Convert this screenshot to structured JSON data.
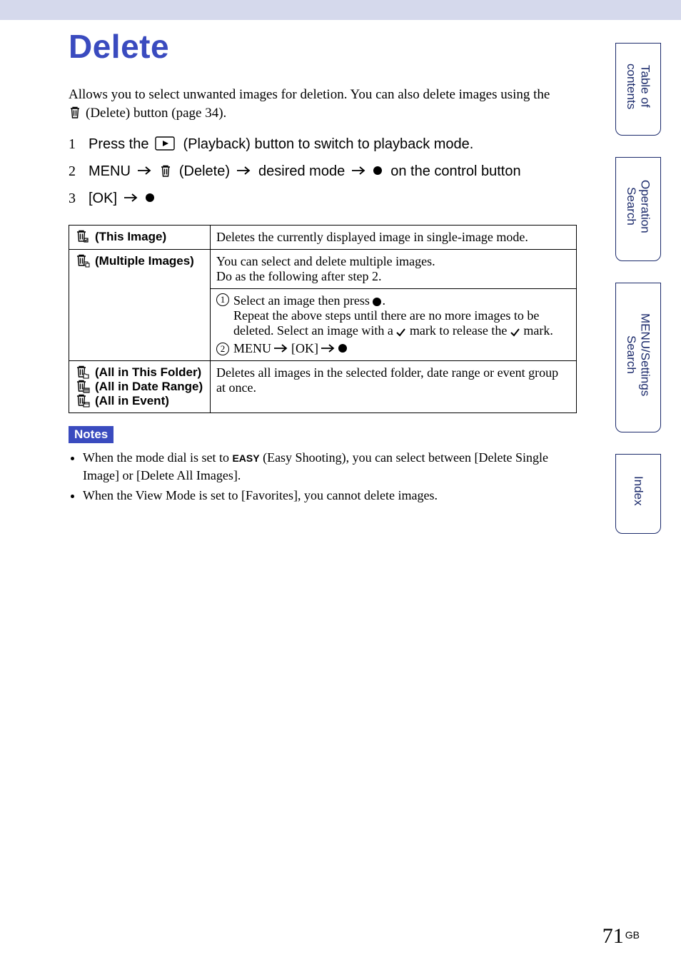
{
  "title": "Delete",
  "intro": {
    "line1": "Allows you to select unwanted images for deletion. You can also delete images using the",
    "line2_suffix": "(Delete) button (page 34)."
  },
  "steps": {
    "s1_a": "Press the",
    "s1_b": "(Playback) button to switch to playback mode.",
    "s2_a": "MENU",
    "s2_b": "(Delete)",
    "s2_c": "desired mode",
    "s2_d": "on the control button",
    "s3_a": "[OK]"
  },
  "table": {
    "r1_label": "(This Image)",
    "r1_desc": "Deletes the currently displayed image in single-image mode.",
    "r2_label": "(Multiple Images)",
    "r2_desc_a": "You can select and delete multiple images.",
    "r2_desc_b": "Do as the following after step 2.",
    "r2_step1_a": "Select an image then press",
    "r2_step1_b": ".",
    "r2_step1_c": "Repeat the above steps until there are no more images to be deleted. Select an image with a",
    "r2_step1_d": "mark to release the",
    "r2_step1_e": "mark.",
    "r2_step2_a": "MENU",
    "r2_step2_b": "[OK]",
    "r3_label_a": "(All in This Folder)",
    "r3_label_b": "(All in Date Range)",
    "r3_label_c": "(All in Event)",
    "r3_desc": "Deletes all images in the selected folder, date range or event group at once."
  },
  "notes": {
    "badge": "Notes",
    "n1_a": "When the mode dial is set to",
    "n1_easy": "EASY",
    "n1_b": "(Easy Shooting), you can select between [Delete Single Image] or [Delete All Images].",
    "n2": "When the View Mode is set to [Favorites], you cannot delete images."
  },
  "tabs": {
    "t1a": "Table of",
    "t1b": "contents",
    "t2a": "Operation",
    "t2b": "Search",
    "t3a": "MENU/Settings",
    "t3b": "Search",
    "t4": "Index"
  },
  "page_number": "71",
  "page_suffix": "GB"
}
